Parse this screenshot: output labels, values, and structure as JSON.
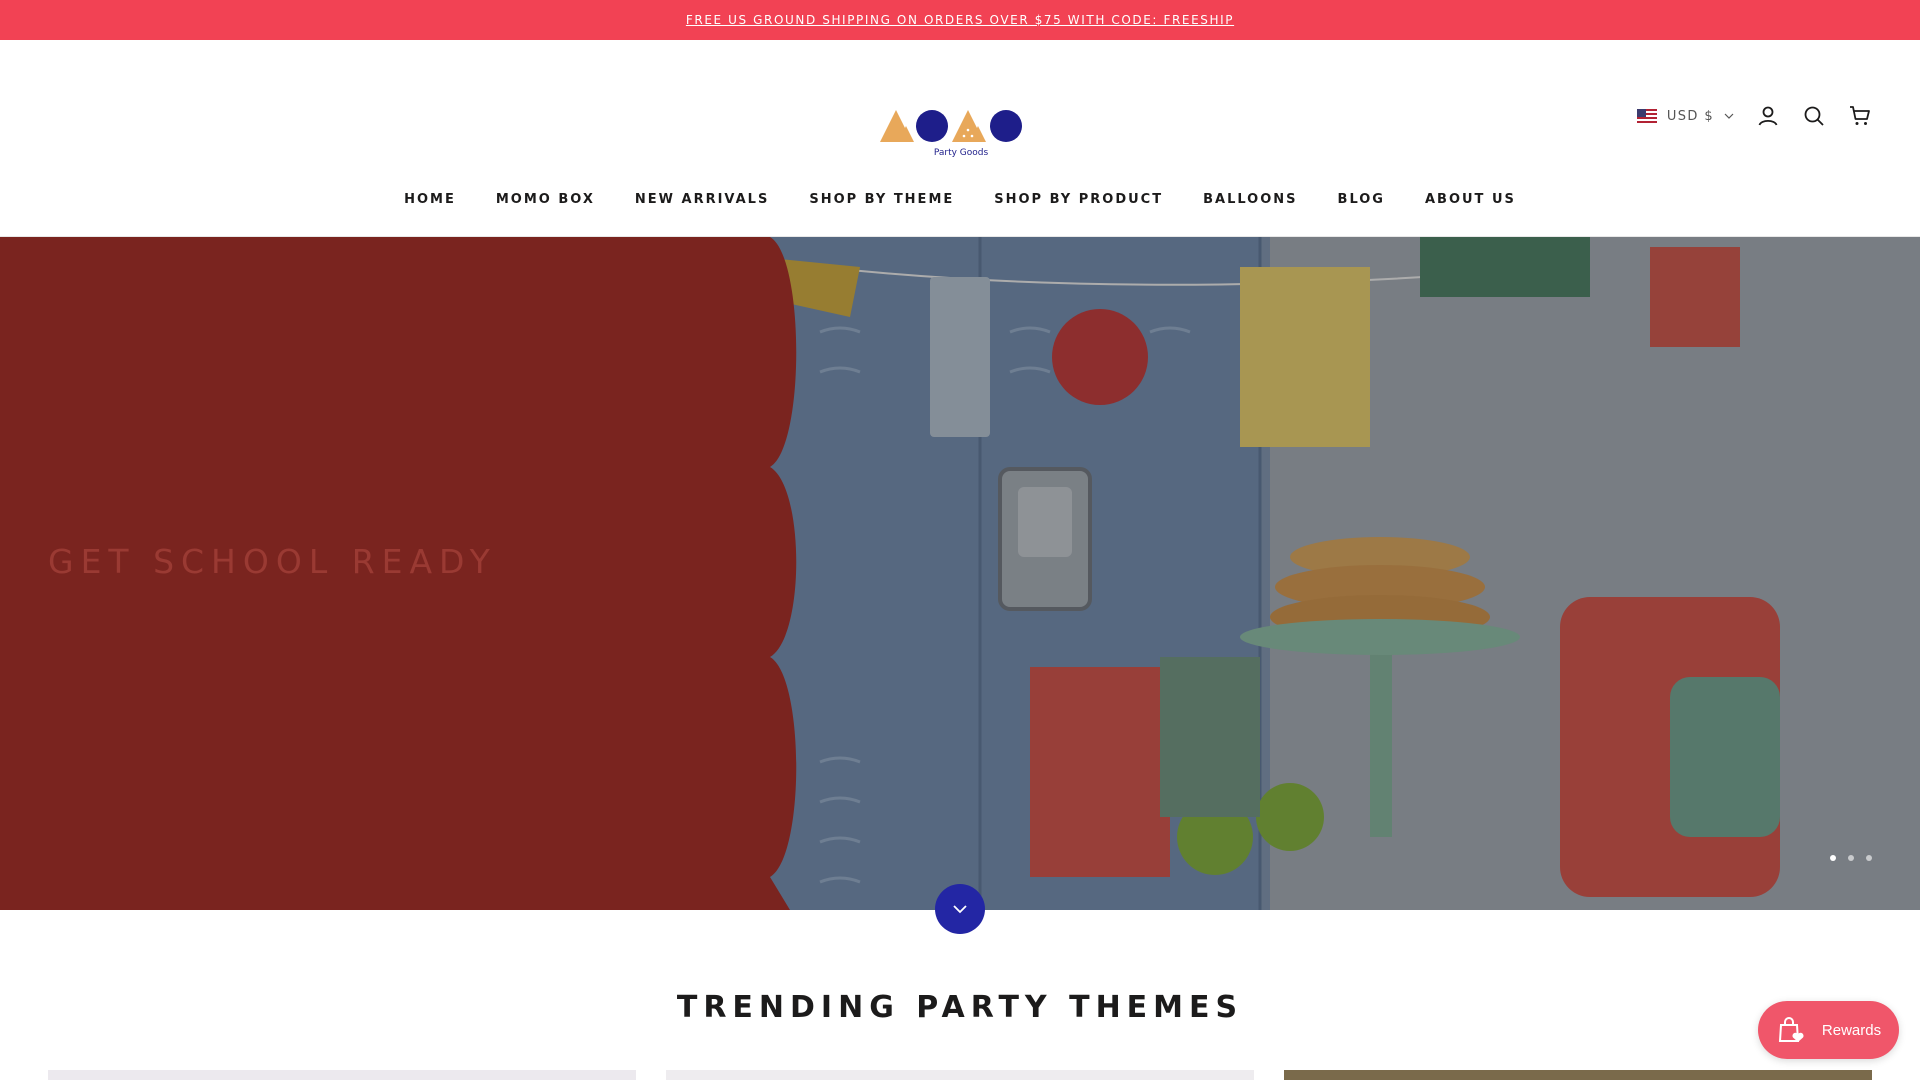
{
  "announcement": {
    "text": "FREE US GROUND SHIPPING ON ORDERS OVER $75 WITH CODE: FREESHIP"
  },
  "header": {
    "logo_text": "MOMO",
    "logo_subtitle": "Party Goods",
    "currency": "USD $",
    "icons": [
      "account-icon",
      "search-icon",
      "cart-icon"
    ]
  },
  "nav": {
    "items": [
      {
        "label": "HOME"
      },
      {
        "label": "MOMO BOX"
      },
      {
        "label": "NEW ARRIVALS"
      },
      {
        "label": "SHOP BY THEME"
      },
      {
        "label": "SHOP BY PRODUCT"
      },
      {
        "label": "BALLOONS"
      },
      {
        "label": "BLOG"
      },
      {
        "label": "ABOUT US"
      }
    ]
  },
  "hero": {
    "title": "GET SCHOOL READY",
    "slide_count": 3,
    "active_slide": 1
  },
  "sections": {
    "trending_title": "TRENDING PARTY THEMES"
  },
  "rewards": {
    "label": "Rewards"
  },
  "colors": {
    "announcement_bg": "#f24254",
    "brand_navy": "#2326a4",
    "brand_orange": "#e8a85a",
    "hero_panel": "#7a241f",
    "rewards_bg": "#f0566a"
  }
}
